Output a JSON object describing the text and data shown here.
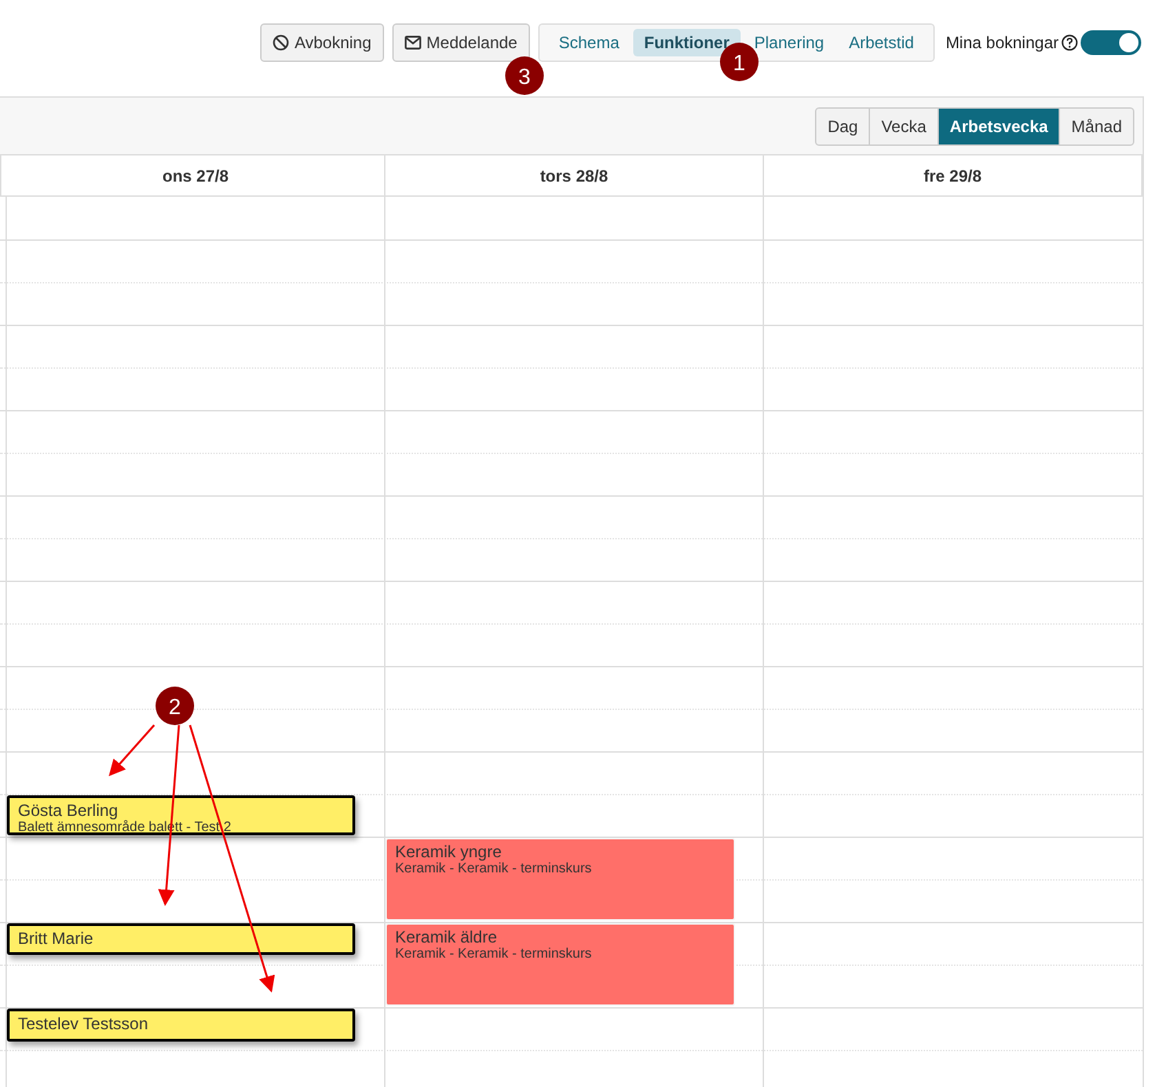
{
  "toolbar": {
    "buttons": [
      {
        "kind": "cancel",
        "label": "Avbokning"
      },
      {
        "kind": "message",
        "label": "Meddelande"
      }
    ],
    "tabs": [
      {
        "label": "Schema",
        "selected": false
      },
      {
        "label": "Funktioner",
        "selected": true
      },
      {
        "label": "Planering",
        "selected": false
      },
      {
        "label": "Arbetstid",
        "selected": false
      }
    ],
    "toggle": {
      "label": "Mina bokningar",
      "on": true
    }
  },
  "views": [
    {
      "label": "Dag",
      "selected": false
    },
    {
      "label": "Vecka",
      "selected": false
    },
    {
      "label": "Arbetsvecka",
      "selected": true
    },
    {
      "label": "Månad",
      "selected": false
    }
  ],
  "days": [
    {
      "label": "ons 27/8",
      "events": [
        {
          "title": "Gösta Berling",
          "subtitle": "Balett ämnesområde balett - Test 2",
          "color": "#ffee66",
          "highlighted": true
        },
        {
          "title": "Britt Marie",
          "color": "#ffee66",
          "highlighted": true
        },
        {
          "title": "Testelev Testsson",
          "color": "#ffee66",
          "highlighted": true
        }
      ]
    },
    {
      "label": "tors 28/8",
      "events": [
        {
          "title": "Keramik yngre",
          "subtitle": "Keramik - Keramik - terminskurs",
          "color": "#ff6f69",
          "highlighted": false
        },
        {
          "title": "Keramik äldre",
          "subtitle": "Keramik - Keramik - terminskurs",
          "color": "#ff6f69",
          "highlighted": false
        }
      ]
    },
    {
      "label": "fre 29/8"
    }
  ],
  "annotations": [
    {
      "label": "1"
    },
    {
      "label": "2"
    },
    {
      "label": "3"
    }
  ]
}
